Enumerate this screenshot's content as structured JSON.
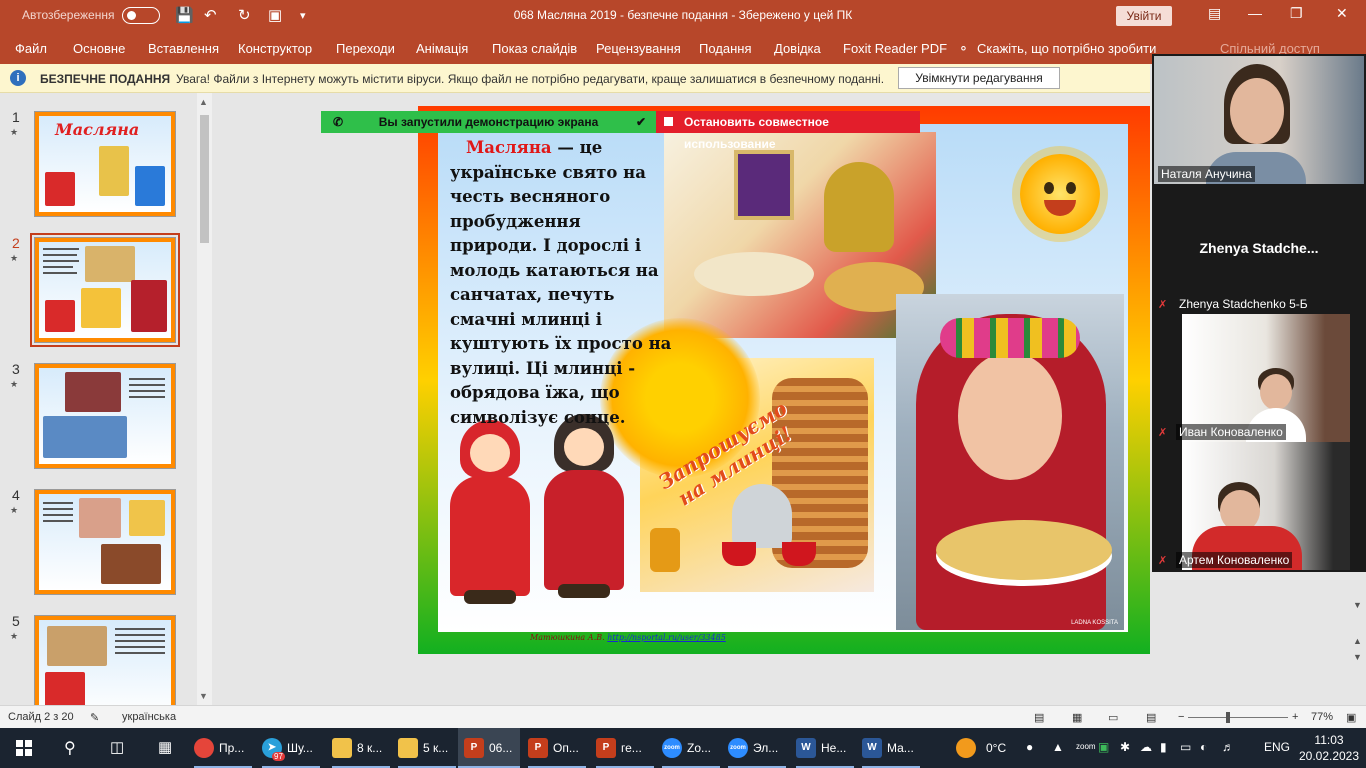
{
  "titlebar": {
    "autosave_label": "Автозбереження",
    "document_title": "068 Масляна 2019  -  безпечне подання  -  Збережено у цей ПК",
    "signin_label": "Увійти"
  },
  "menu": {
    "tabs": [
      "Файл",
      "Основне",
      "Вставлення",
      "Конструктор",
      "Переходи",
      "Анімація",
      "Показ слайдів",
      "Рецензування",
      "Подання",
      "Довідка",
      "Foxit Reader PDF"
    ],
    "tell_me": "Скажіть, що потрібно зробити",
    "share": "Спільний доступ"
  },
  "protected_view": {
    "title": "БЕЗПЕЧНЕ ПОДАННЯ",
    "message": "Увага! Файли з Інтернету можуть містити віруси. Якщо файл не потрібно редагувати, краще залишатися в безпечному поданні.",
    "enable_button": "Увімкнути редагування"
  },
  "thumbnails": [
    {
      "num": "1",
      "title": "Масляна"
    },
    {
      "num": "2",
      "title": ""
    },
    {
      "num": "3",
      "title": ""
    },
    {
      "num": "4",
      "title": ""
    },
    {
      "num": "5",
      "title": ""
    }
  ],
  "slide": {
    "highlight_word": "Масляна",
    "body_text": " — це українське свято на честь весняного пробудження природи. І дорослі і молодь катаються на санчатах, печуть смачні млинці і куштують їх просто на вулиці. Ці млинці - обрядова їжа, що символізує сонце.",
    "pancake_caption_1": "Запрошуємо",
    "pancake_caption_2": "на млинці!",
    "credit_author": "Матюшкина А.В.",
    "credit_link": "http://nsportal.ru/user/33485",
    "brand": "LADNA KOSSITA"
  },
  "screen_share": {
    "started_label": "Вы запустили демонстрацию экрана",
    "stop_label": "Остановить совместное использование"
  },
  "participants": [
    {
      "name": "Наталя Анучина",
      "muted": false
    },
    {
      "name": "Zhenya  Stadche...",
      "muted": false,
      "label": "Zhenya Stadchenko 5-Б"
    },
    {
      "name": "Иван Коноваленко",
      "muted": true
    },
    {
      "name": "Артем Коноваленко",
      "muted": true
    }
  ],
  "status": {
    "slide_counter": "Слайд 2 з 20",
    "language": "українська",
    "zoom": "77%"
  },
  "taskbar": {
    "apps": [
      {
        "label": "Пр...",
        "icon": "chrome"
      },
      {
        "label": "Шу...",
        "icon": "telegram",
        "badge": "97"
      },
      {
        "label": "8 к...",
        "icon": "folder"
      },
      {
        "label": "5 к...",
        "icon": "folder"
      },
      {
        "label": "06...",
        "icon": "powerpoint"
      },
      {
        "label": "Оп...",
        "icon": "powerpoint"
      },
      {
        "label": "ге...",
        "icon": "powerpoint"
      },
      {
        "label": "Zo...",
        "icon": "zoom"
      },
      {
        "label": "Эл...",
        "icon": "zoom"
      },
      {
        "label": "Не...",
        "icon": "word"
      },
      {
        "label": "Ма...",
        "icon": "word"
      }
    ],
    "weather": "0°C",
    "language": "ENG",
    "time": "11:03",
    "date": "20.02.2023"
  },
  "colors": {
    "accent": "#b7472a",
    "share_green": "#2fbf4a",
    "share_red": "#e31e2b"
  }
}
